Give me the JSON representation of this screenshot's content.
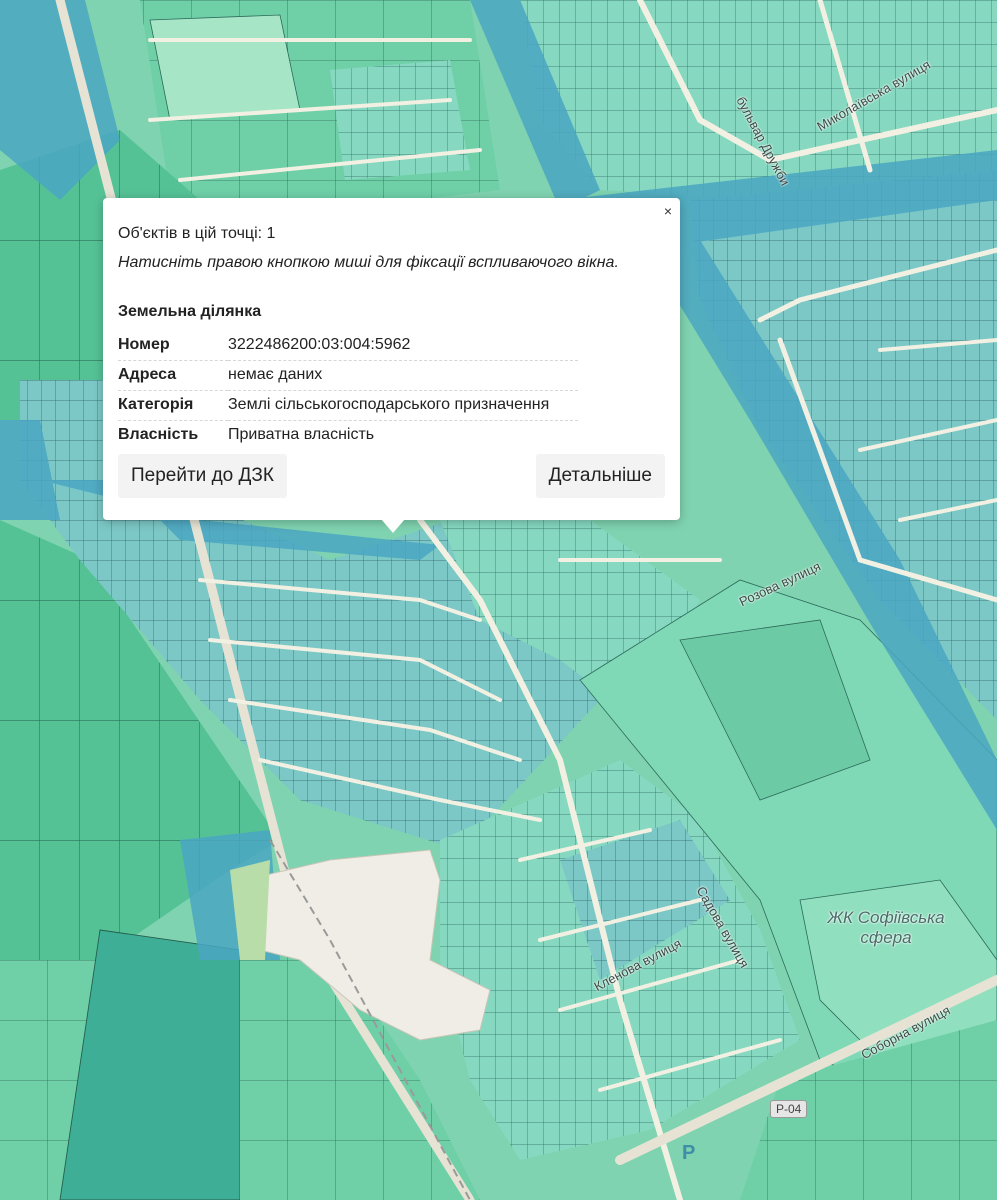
{
  "popup": {
    "close_label": "×",
    "count_text": "Об'єктів в цій точці: 1",
    "hint_text": "Натисніть правою кнопкою миші для фіксації вспливаючого вікна.",
    "heading": "Земельна ділянка",
    "rows": [
      {
        "key": "Номер",
        "value": "3222486200:03:004:5962"
      },
      {
        "key": "Адреса",
        "value": "немає даних"
      },
      {
        "key": "Категорія",
        "value": "Землі сільськогосподарського призначення"
      },
      {
        "key": "Власність",
        "value": "Приватна власність"
      }
    ],
    "button_dzk": "Перейти до ДЗК",
    "button_more": "Детальніше"
  },
  "map": {
    "labels": {
      "street_1": "Соборна вулиця",
      "street_2": "бульвар Дружби",
      "street_3": "Миколаївська вулиця",
      "street_4": "Садова вулиця",
      "street_5": "Розова вулиця",
      "street_6": "Кленова вулиця",
      "complex": "ЖК Софіївська сфера",
      "route": "Р-04",
      "parking": "P"
    },
    "colors": {
      "parcel_light": "#8ee0bb",
      "parcel_mid": "#62c6a6",
      "parcel_dark": "#3aa89a",
      "canal": "#4aa6c2",
      "road": "#f2f0e2",
      "built": "#efede6"
    }
  }
}
